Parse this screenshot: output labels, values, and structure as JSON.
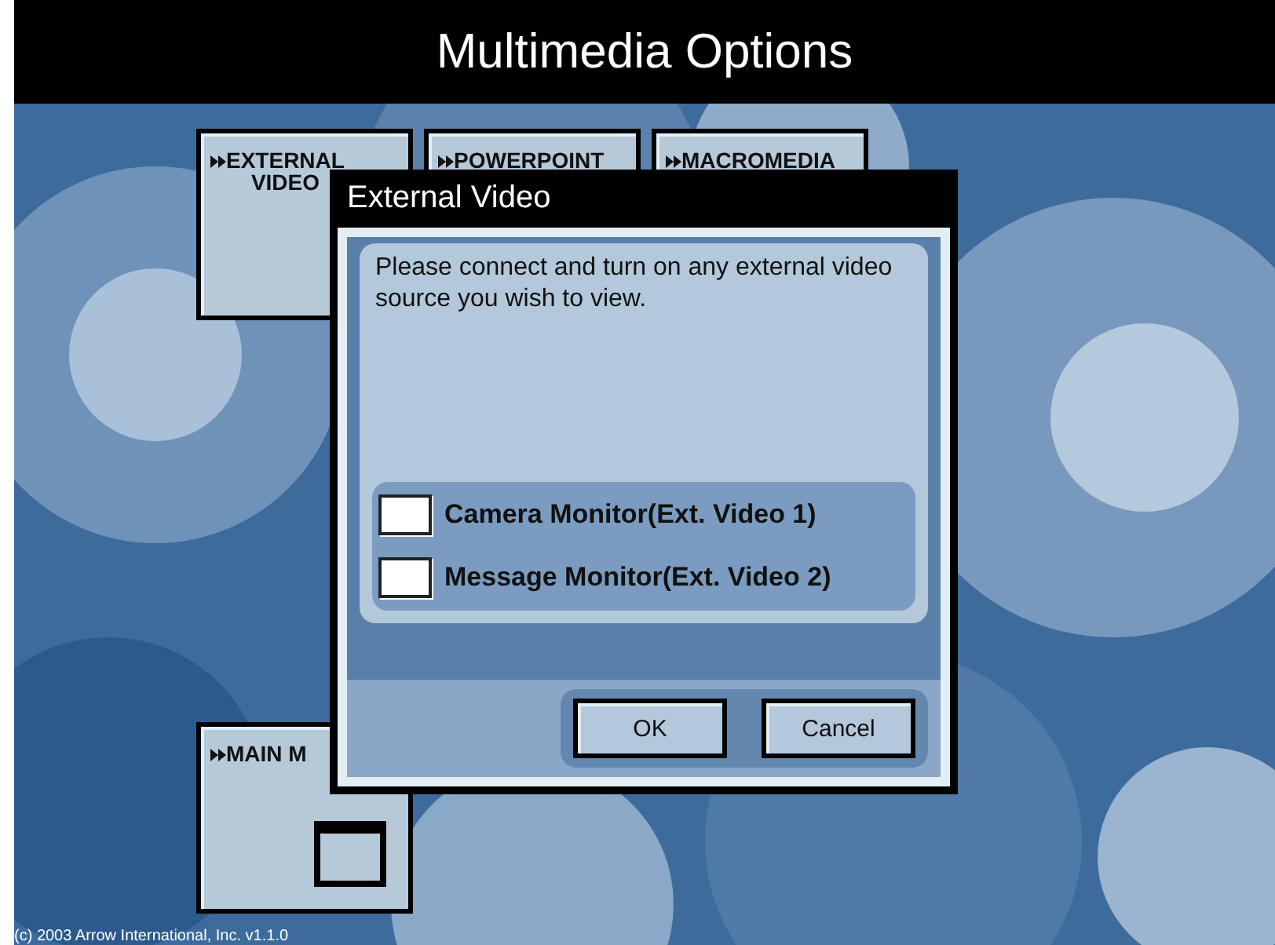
{
  "header": {
    "title": "Multimedia Options"
  },
  "tiles": [
    {
      "label_lines": [
        "EXTERNAL",
        "VIDEO"
      ],
      "kind": "plain"
    },
    {
      "label_lines": [
        "POWERPOINT"
      ],
      "kind": "plain"
    },
    {
      "label_lines": [
        "MACROMEDIA"
      ],
      "kind": "plain"
    },
    {
      "label_lines": [
        "MAIN M"
      ],
      "kind": "window"
    }
  ],
  "dialog": {
    "title": "External Video",
    "message": "Please connect and turn on any external video source you wish to view.",
    "options": [
      {
        "label": "Camera Monitor(Ext. Video 1)",
        "checked": false
      },
      {
        "label": "Message Monitor(Ext. Video 2)",
        "checked": false
      }
    ],
    "buttons": [
      "OK",
      "Cancel"
    ]
  },
  "footer": {
    "copyright": "(c) 2003 Arrow International, Inc. v1.1.0"
  }
}
